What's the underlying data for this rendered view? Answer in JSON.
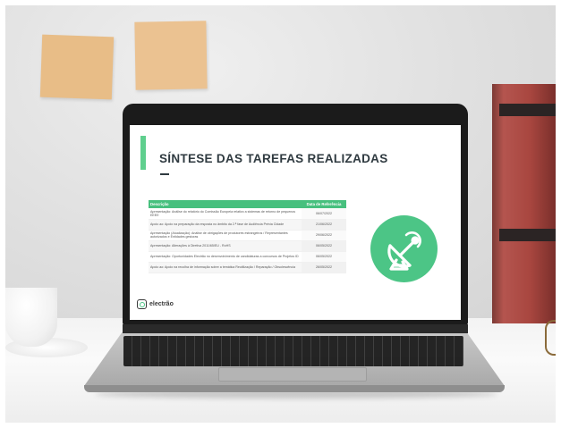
{
  "slide": {
    "title": "SÍNTESE DAS TAREFAS REALIZADAS",
    "table": {
      "headers": [
        "Descrição",
        "Data de Referência"
      ],
      "rows": [
        {
          "desc": "Apresentação: Análise do relatório do Comissão Europeia relativo a sistemas de retorno de pequenos EEEE",
          "date": "06/07/2022"
        },
        {
          "desc": "Apoio ao: Apoio na preparação da resposta no âmbito da 2.ª fase de Audiência Prévia Cidade",
          "date": "21/06/2022"
        },
        {
          "desc": "Apresentação (Atualização): Análise de obrigações de produtores estrangeiros / Representantes autorizados e Entidades gestoras",
          "date": "29/06/2022"
        },
        {
          "desc": "Apresentação: Alterações à Diretiva 2011/65/EU - RoHS",
          "date": "06/05/2022"
        },
        {
          "desc": "Apresentação: Oportunidades Electrão no desenvolvimento de candidaturas a concursos de Projetos ID",
          "date": "06/05/2022"
        },
        {
          "desc": "Apoio ao: Apoio na recolha de informação sobre a temática Reutilização / Reparação / Obsolescência",
          "date": "26/05/2022"
        }
      ]
    },
    "icon": "satellite-dish-icon",
    "logo_text": "electrão"
  },
  "colors": {
    "accent_green": "#4cc586",
    "table_header": "#47c07e",
    "title_text": "#2f3a40"
  }
}
